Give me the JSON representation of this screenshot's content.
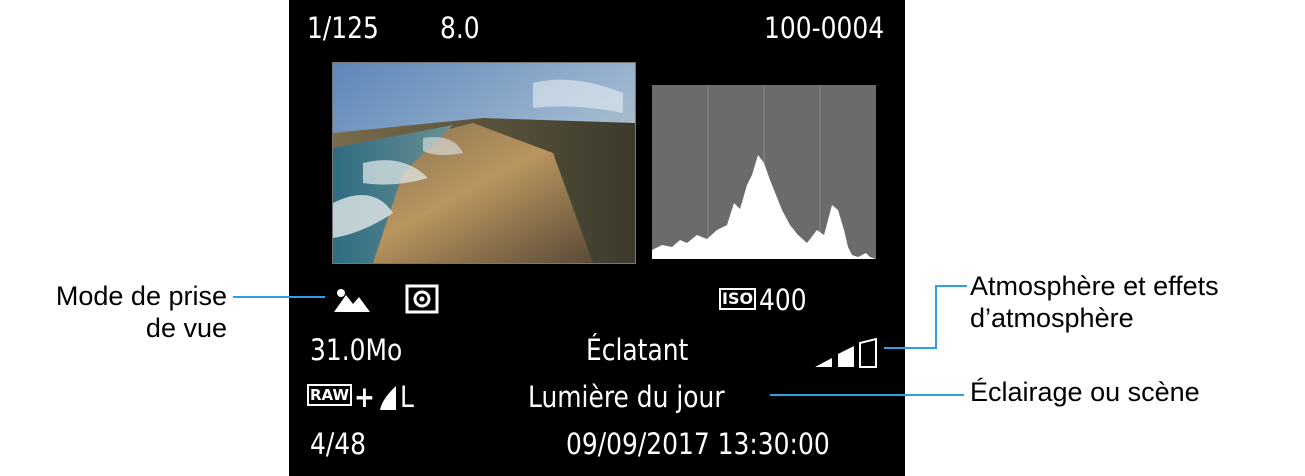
{
  "screen": {
    "shutter_speed": "1/125",
    "aperture": "8.0",
    "file_number": "100-0004",
    "iso_badge": "ISO",
    "iso_value": "400",
    "file_size": "31.0Mo",
    "ambience": "Éclatant",
    "lighting": "Lumière du jour",
    "raw_badge": "RAW",
    "quality_plus": "+",
    "quality_size": "L",
    "image_index": "4/48",
    "datetime": "09/09/2017 13:30:00",
    "icons": [
      "landscape-mode-icon",
      "metering-icon",
      "ambience-effect-level-icon",
      "jpeg-quality-icon"
    ]
  },
  "callouts": {
    "shooting_mode_line1": "Mode de prise",
    "shooting_mode_line2": "de vue",
    "ambience_line1": "Atmosphère et effets",
    "ambience_line2": "d’atmosphère",
    "lighting": "Éclairage ou scène"
  },
  "colors": {
    "leader_line": "#2f9ee6",
    "screen_bg": "#000000",
    "text": "#ffffff"
  }
}
